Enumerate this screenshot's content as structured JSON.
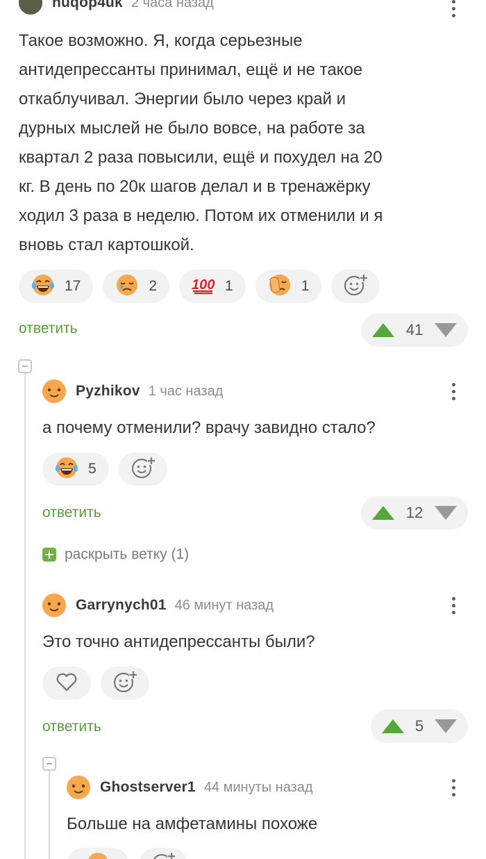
{
  "comments": [
    {
      "username": "nuqop4uk",
      "time": "2 часа назад",
      "text_lines": [
        "Такое возможно. Я, когда серьезные",
        "антидепрессанты принимал, ещё и не такое",
        "откаблучивал. Энергии было через край и",
        "дурных мыслей не было вовсе, на работе за",
        "квартал 2 раза повысили, ещё и похудел на 20",
        "кг. В день по 20к шагов делал и в тренажёрку",
        "ходил 3 раза в неделю. Потом их отменили и я",
        "вновь стал картошкой."
      ],
      "reactions": [
        {
          "icon": "laughing-tears-emoji",
          "count": "17"
        },
        {
          "icon": "sad-face-emoji",
          "count": "2"
        },
        {
          "icon": "hundred-emoji",
          "glyph": "💯",
          "count": "1"
        },
        {
          "icon": "facepalm-emoji",
          "count": "1"
        }
      ],
      "reply_label": "ответить",
      "score": "41"
    },
    {
      "username": "Pyzhikov",
      "time": "1 час назад",
      "text": "а почему отменили? врачу завидно стало?",
      "reactions": [
        {
          "icon": "laughing-tears-emoji",
          "count": "5"
        }
      ],
      "reply_label": "ответить",
      "score": "12",
      "expand_label": "раскрыть ветку (1)"
    },
    {
      "username": "Garrynych01",
      "time": "46 минут назад",
      "text": "Это точно антидепрессанты были?",
      "reply_label": "ответить",
      "score": "5"
    },
    {
      "username": "Ghostserver1",
      "time": "44 минуты назад",
      "text": "Больше на амфетамины похоже"
    }
  ],
  "colors": {
    "accent_green": "#5a9e3b",
    "upvote": "#58a839",
    "downvote": "#999999",
    "pill_bg": "#f2f2f2",
    "avatar_orange": "#f7a84f"
  }
}
